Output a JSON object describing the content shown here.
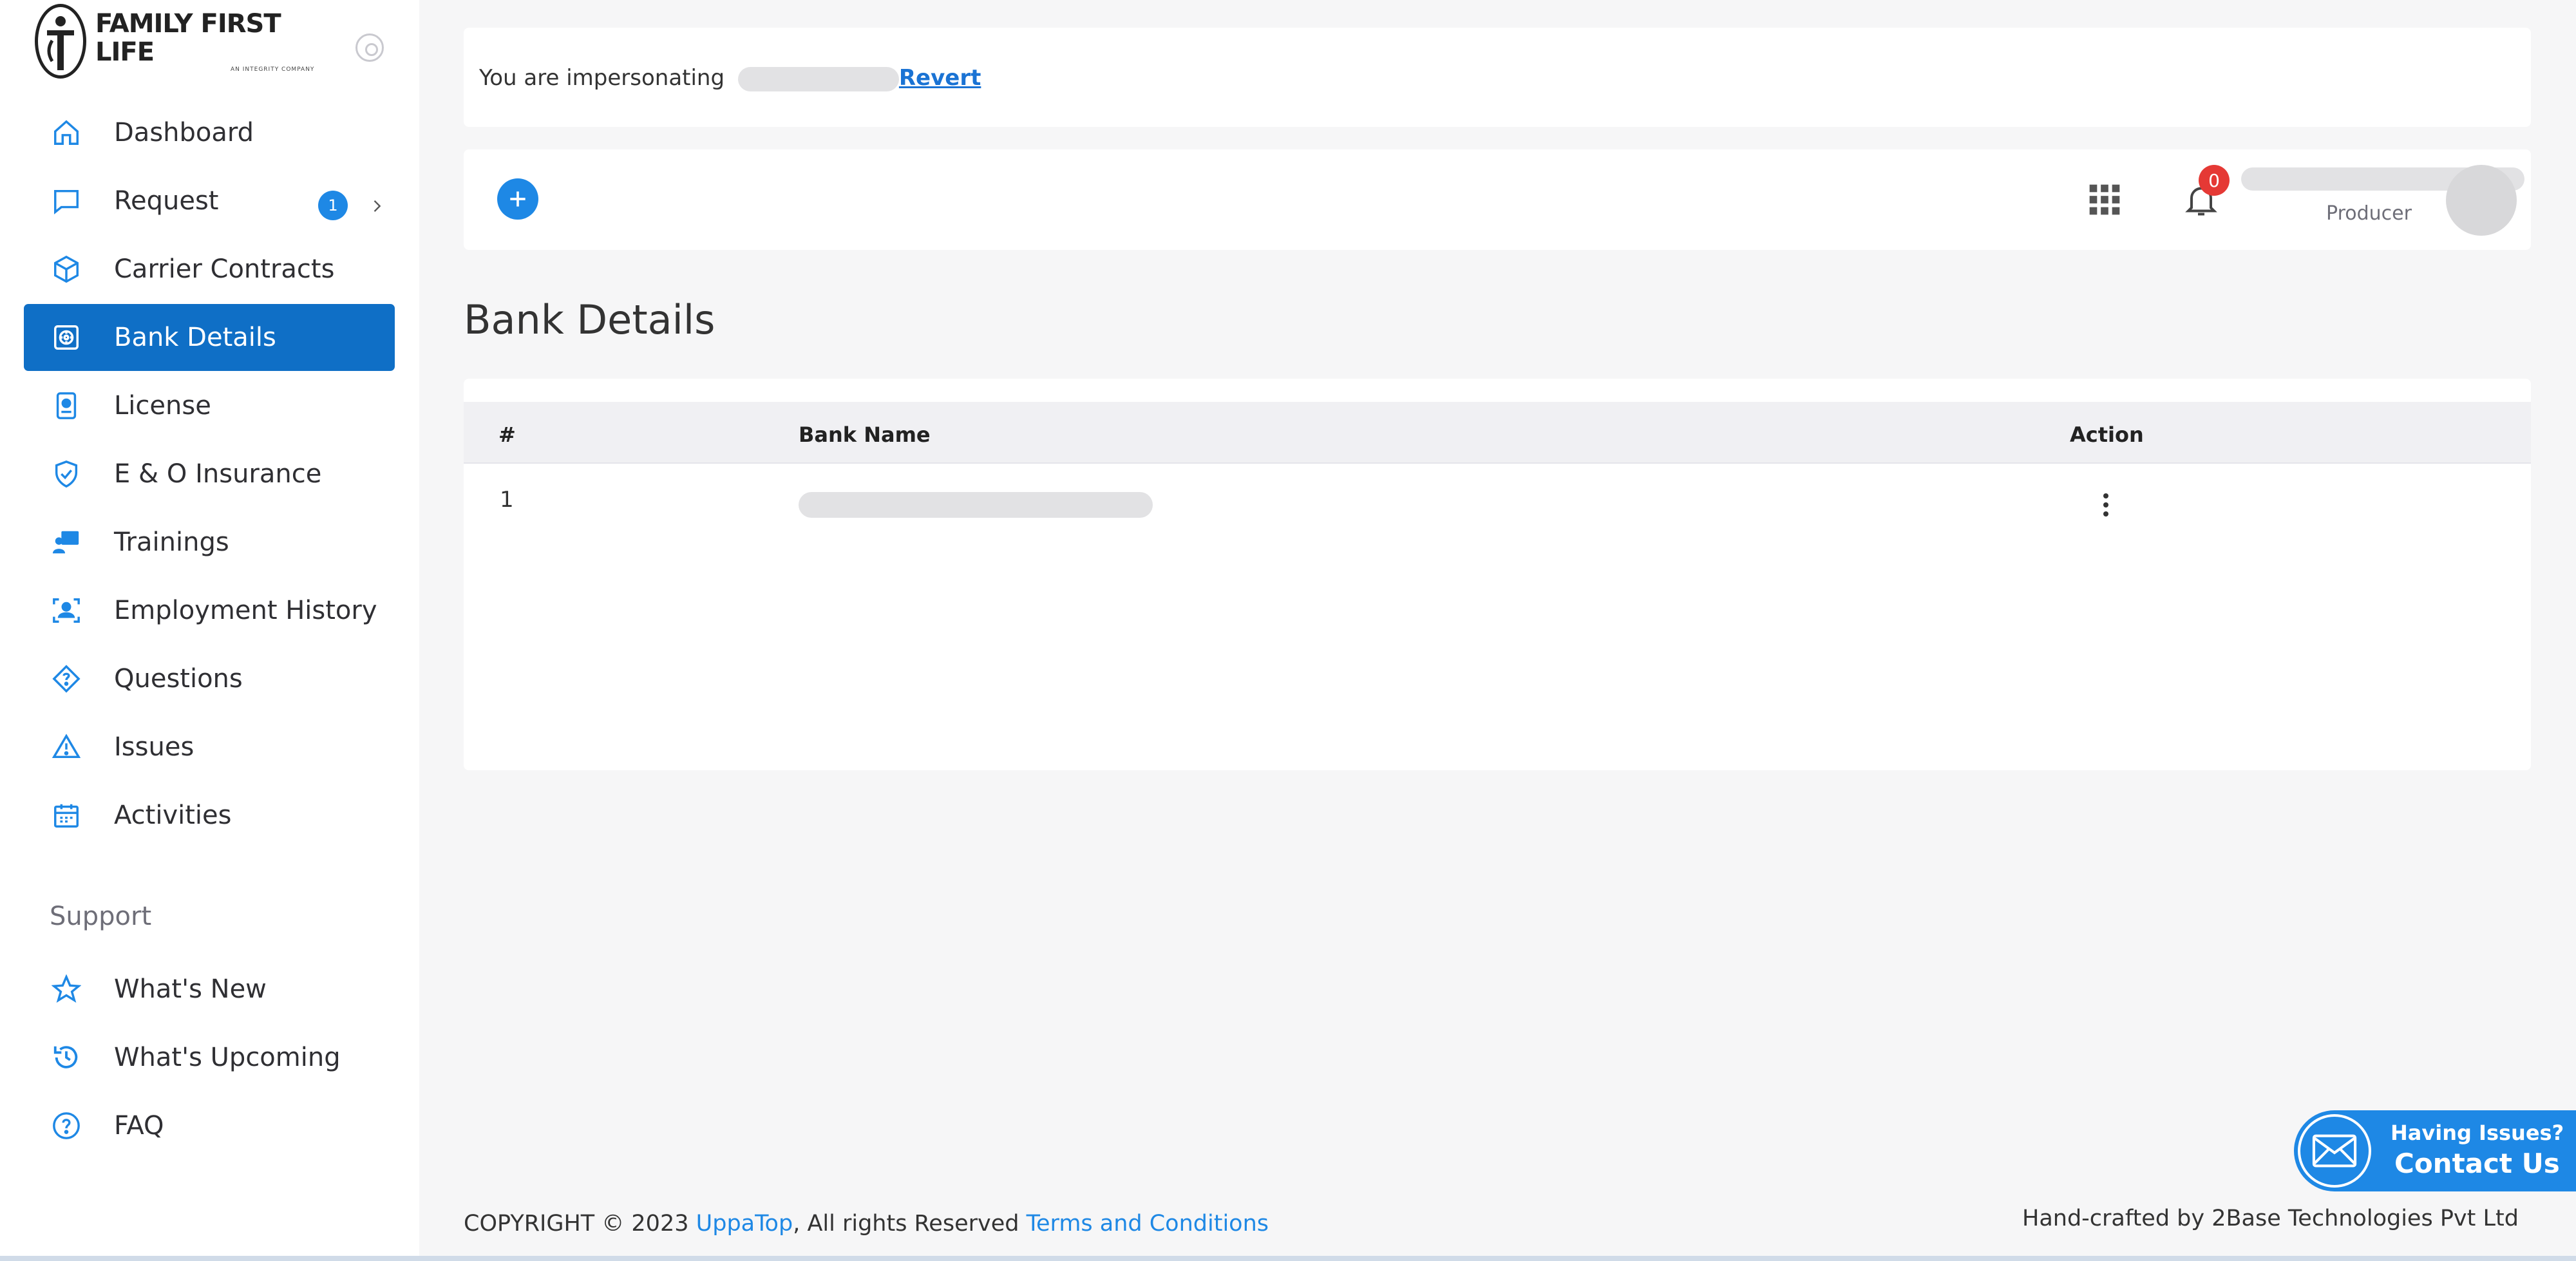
{
  "brand": {
    "name": "FAMILY FIRST LIFE",
    "tagline": "AN INTEGRITY COMPANY"
  },
  "sidebar": {
    "items": [
      {
        "label": "Dashboard",
        "icon": "home-icon"
      },
      {
        "label": "Request",
        "icon": "chat-bubble-icon",
        "badge": "1"
      },
      {
        "label": "Carrier Contracts",
        "icon": "box-icon"
      },
      {
        "label": "Bank Details",
        "icon": "vault-icon",
        "active": true
      },
      {
        "label": "License",
        "icon": "id-badge-icon"
      },
      {
        "label": "E & O Insurance",
        "icon": "shield-icon"
      },
      {
        "label": "Trainings",
        "icon": "training-icon"
      },
      {
        "label": "Employment History",
        "icon": "person-frame-icon"
      },
      {
        "label": "Questions",
        "icon": "question-diamond-icon"
      },
      {
        "label": "Issues",
        "icon": "warning-icon"
      },
      {
        "label": "Activities",
        "icon": "calendar-icon"
      }
    ],
    "support_label": "Support",
    "support_items": [
      {
        "label": "What's New",
        "icon": "star-icon"
      },
      {
        "label": "What's Upcoming",
        "icon": "history-icon"
      },
      {
        "label": "FAQ",
        "icon": "help-circle-icon"
      }
    ]
  },
  "impersonation": {
    "text": "You are impersonating",
    "revert_label": "Revert"
  },
  "topbar": {
    "notification_count": "0",
    "user_role": "Producer"
  },
  "page": {
    "title": "Bank Details"
  },
  "table": {
    "columns": [
      "#",
      "Bank Name",
      "Action"
    ],
    "rows": [
      {
        "index": "1"
      }
    ]
  },
  "footer": {
    "copyright_prefix": "COPYRIGHT © 2023 ",
    "company_link": "UppaTop",
    "rights": ", All rights Reserved ",
    "terms_link": "Terms and Conditions",
    "credits": "Hand-crafted by 2Base Technologies Pvt Ltd"
  },
  "contact_widget": {
    "line1": "Having Issues?",
    "line2": "Contact Us"
  },
  "colors": {
    "accent": "#1e88e5",
    "active_bg": "#0f6fc6",
    "alert": "#e53935"
  }
}
